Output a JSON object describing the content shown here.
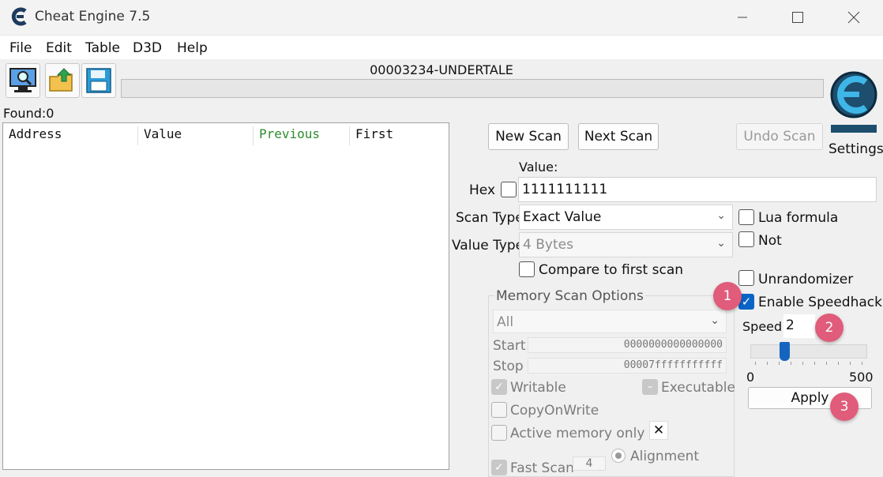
{
  "window": {
    "title": "Cheat Engine 7.5",
    "controls": [
      "minimize-icon",
      "maximize-icon",
      "close-icon"
    ]
  },
  "menu": [
    "File",
    "Edit",
    "Table",
    "D3D",
    "Help"
  ],
  "toolbar": {
    "icons": [
      "process-list-icon",
      "open-folder-icon",
      "save-icon"
    ],
    "process_name": "00003234-UNDERTALE"
  },
  "found_label": "Found:0",
  "results": {
    "columns": [
      "Address",
      "Value",
      "Previous",
      "First"
    ],
    "rows": []
  },
  "scan": {
    "new_scan": "New Scan",
    "next_scan": "Next Scan",
    "undo_scan": "Undo Scan",
    "settings": "Settings",
    "value_label": "Value:",
    "hex_label": "Hex",
    "value": "1111111111",
    "scan_type_label": "Scan Type",
    "scan_type": "Exact Value",
    "value_type_label": "Value Type",
    "value_type": "4 Bytes",
    "compare_first": "Compare to first scan",
    "lua_formula": "Lua formula",
    "not": "Not",
    "unrandomizer": "Unrandomizer",
    "enable_speedhack": "Enable Speedhack"
  },
  "memory_options": {
    "title": "Memory Scan Options",
    "region": "All",
    "start_label": "Start",
    "start": "0000000000000000",
    "stop_label": "Stop",
    "stop": "00007fffffffffff",
    "writable": "Writable",
    "executable": "Executable",
    "copy_on_write": "CopyOnWrite",
    "active_memory": "Active memory only",
    "fast_scan": "Fast Scan",
    "fast_scan_value": "4",
    "alignment": "Alignment"
  },
  "speedhack": {
    "speed_label": "Speed",
    "speed": "2",
    "min": "0",
    "max": "500",
    "slider_value": 2,
    "apply": "Apply"
  },
  "badges": [
    "1",
    "2",
    "3"
  ],
  "colors": {
    "accent": "#0a64c6",
    "badge": "#e05c7a",
    "previous_header": "#2e8b2e"
  }
}
